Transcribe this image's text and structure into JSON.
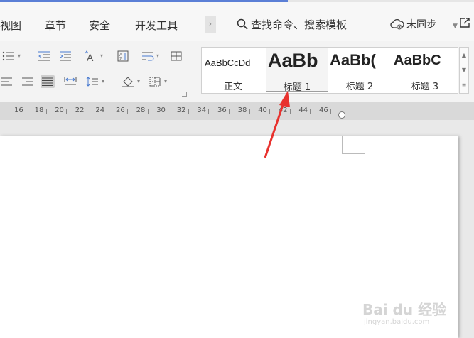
{
  "menu_tabs": {
    "view": "视图",
    "chapter": "章节",
    "security": "安全",
    "dev_tools": "开发工具",
    "more": "›"
  },
  "search": {
    "label": "查找命令、搜索模板"
  },
  "sync": {
    "label": "未同步"
  },
  "styles": {
    "normal": {
      "preview": "AaBbCcDd",
      "name": "正文"
    },
    "heading1": {
      "preview": "AaBb",
      "name": "标题 1"
    },
    "heading2": {
      "preview": "AaBb(",
      "name": "标题 2"
    },
    "heading3": {
      "preview": "AaBbC",
      "name": "标题 3"
    }
  },
  "ruler": {
    "numbers": [
      "16",
      "18",
      "20",
      "22",
      "24",
      "26",
      "28",
      "30",
      "32",
      "34",
      "36",
      "38",
      "40",
      "42",
      "44",
      "46"
    ]
  },
  "watermark": {
    "brand": "Bai du 经验",
    "url": "jingyan.baidu.com"
  },
  "colors": {
    "accent": "#5b7fd6",
    "arrow": "#e8322e"
  }
}
